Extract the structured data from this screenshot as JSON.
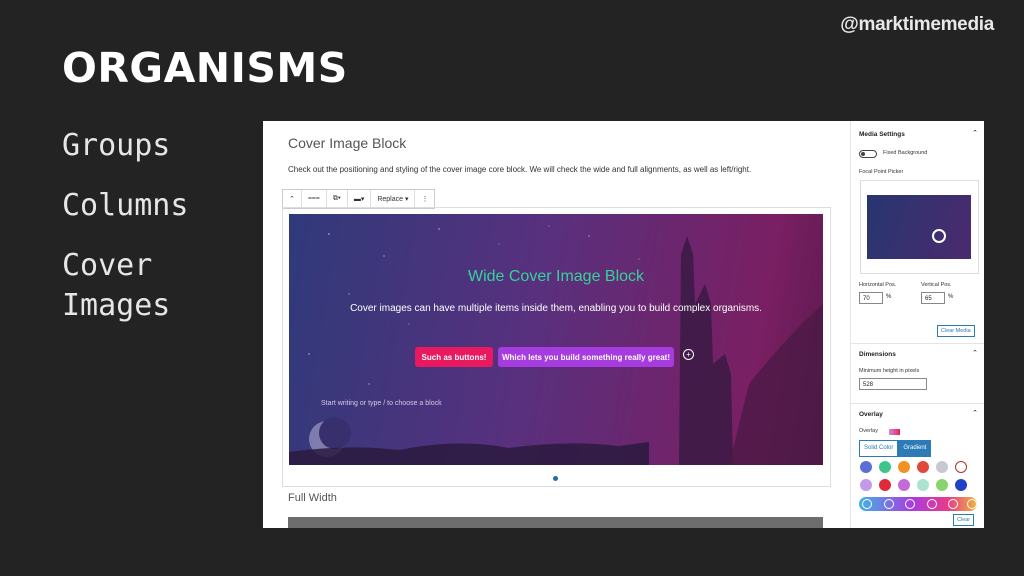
{
  "handle": "@marktimemedia",
  "title": "ORGANISMS",
  "topics": [
    "Groups",
    "Columns",
    "Cover Images"
  ],
  "editor": {
    "heading": "Cover Image Block",
    "paragraph": "Check out the positioning and styling of the cover image core block. We will check the wide and full alignments, as well as left/right.",
    "toolbar": {
      "up": "⌃",
      "move": "⩶",
      "align": "⧉▾",
      "width": "▬▾",
      "replace": "Replace ▾",
      "more": "⋮"
    },
    "cover": {
      "title": "Wide Cover Image Block",
      "text": "Cover images can have multiple items inside them, enabling you to build complex organisms.",
      "button1": "Such as buttons!",
      "button2": "Which lets you build something really great!",
      "add": "+",
      "placeholder": "Start writing or type / to choose a block"
    },
    "next_heading": "Full Width"
  },
  "sidebar": {
    "media_settings": "Media Settings",
    "fixed_background": "Fixed Background",
    "focal_point_picker": "Focal Point Picker",
    "horizontal_pos_label": "Horizontal Pos.",
    "vertical_pos_label": "Vertical Pos.",
    "horizontal_pos_value": "70",
    "vertical_pos_value": "65",
    "percent": "%",
    "clear_media": "Clear Media",
    "dimensions": "Dimensions",
    "min_height_label": "Minimum height in pixels",
    "min_height_value": "528",
    "overlay": "Overlay",
    "overlay_label": "Overlay",
    "solid_color_tab": "Solid Color",
    "gradient_tab": "Gradient",
    "clear": "Clear",
    "chevron": "⌃",
    "swatches_row1": [
      "#5b6fd6",
      "#3ec58a",
      "#f39122",
      "#e0483a",
      "#c8c8d0",
      "#ffffff"
    ],
    "swatches_row2": [
      "#c39ae6",
      "#e02a3c",
      "#c46ad6",
      "#a9e3d2",
      "#88d46c",
      "#2140c8"
    ],
    "accent_color": "#2c7bb6"
  }
}
